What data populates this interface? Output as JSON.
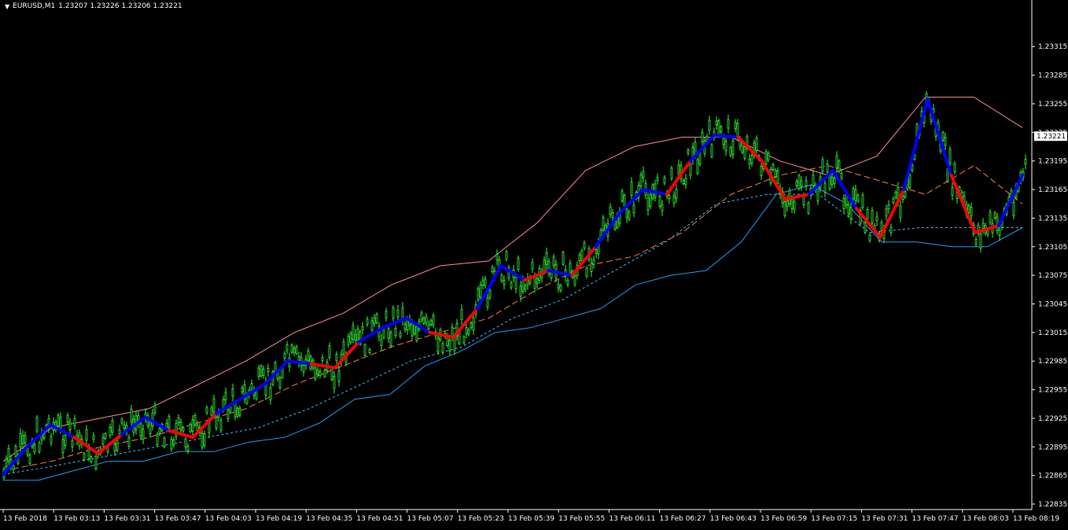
{
  "header": {
    "symbol": "EURUSD,M1",
    "ohlc": "1.23207 1.23226 1.23206 1.23221"
  },
  "colors": {
    "background": "#000000",
    "axis": "#ffffff",
    "bull_candle": "#32ff32",
    "bear_candle": "#32ff32",
    "line_up": "#0000ff",
    "line_down": "#ff0000",
    "band_outer_low": "#1ea0ff",
    "band_inner_low": "#3cc8ff",
    "band_mid": "#ff7f50",
    "band_upper": "#ff9090",
    "band_upper_inner": "#ffb0b0",
    "price_label_bg": "#ffffff"
  },
  "chart_data": {
    "type": "line",
    "title": "",
    "xlabel": "",
    "ylabel": "",
    "ylim": [
      1.22835,
      1.23335
    ],
    "current_price": "1.23221",
    "y_ticks": [
      "1.23315",
      "1.23285",
      "1.23255",
      "1.23225",
      "1.23195",
      "1.23165",
      "1.23135",
      "1.23105",
      "1.23075",
      "1.23045",
      "1.23015",
      "1.22985",
      "1.22955",
      "1.22925",
      "1.22895",
      "1.22865",
      "1.22835"
    ],
    "x_ticks": [
      "13 Feb 2018",
      "13 Feb 03:13",
      "13 Feb 03:31",
      "13 Feb 03:47",
      "13 Feb 04:03",
      "13 Feb 04:19",
      "13 Feb 04:35",
      "13 Feb 04:51",
      "13 Feb 05:07",
      "13 Feb 05:23",
      "13 Feb 05:39",
      "13 Feb 05:55",
      "13 Feb 06:11",
      "13 Feb 06:27",
      "13 Feb 06:43",
      "13 Feb 06:59",
      "13 Feb 07:15",
      "13 Feb 07:31",
      "13 Feb 07:47",
      "13 Feb 08:03",
      "13 Feb 08:19"
    ],
    "series": [
      {
        "role": "trend",
        "values": [
          1.22866,
          1.22895,
          1.22918,
          1.22905,
          1.22888,
          1.22908,
          1.22926,
          1.22912,
          1.22905,
          1.2293,
          1.22945,
          1.2296,
          1.22985,
          1.22982,
          1.22978,
          1.23005,
          1.2302,
          1.2303,
          1.23015,
          1.2301,
          1.2304,
          1.23085,
          1.2307,
          1.2308,
          1.23075,
          1.23105,
          1.2314,
          1.23165,
          1.2316,
          1.23195,
          1.23222,
          1.2322,
          1.23195,
          1.23155,
          1.2316,
          1.23185,
          1.23145,
          1.23115,
          1.23165,
          1.2326,
          1.2318,
          1.2312,
          1.23127,
          1.2318
        ],
        "direction": [
          "up",
          "up",
          "up",
          "down",
          "down",
          "up",
          "up",
          "down",
          "down",
          "up",
          "up",
          "up",
          "up",
          "down",
          "down",
          "up",
          "up",
          "up",
          "down",
          "down",
          "up",
          "up",
          "down",
          "up",
          "down",
          "up",
          "up",
          "up",
          "down",
          "up",
          "up",
          "down",
          "down",
          "down",
          "up",
          "up",
          "down",
          "down",
          "up",
          "up",
          "down",
          "down",
          "up",
          "up"
        ]
      },
      {
        "role": "lower-band-outer",
        "values": [
          1.2286,
          1.2286,
          1.2287,
          1.2288,
          1.2288,
          1.2289,
          1.2289,
          1.229,
          1.22905,
          1.2292,
          1.22945,
          1.2295,
          1.2298,
          1.22995,
          1.23015,
          1.2302,
          1.2303,
          1.2304,
          1.23065,
          1.23075,
          1.2308,
          1.2311,
          1.2316,
          1.2317,
          1.2315,
          1.2311,
          1.2311,
          1.23105,
          1.23105,
          1.23125
        ]
      },
      {
        "role": "lower-band-inner",
        "values": [
          1.22866,
          1.22875,
          1.22885,
          1.22895,
          1.22905,
          1.22915,
          1.22935,
          1.2296,
          1.22985,
          1.23,
          1.2303,
          1.2305,
          1.2308,
          1.2311,
          1.2315,
          1.2316,
          1.2316,
          1.2312,
          1.23125,
          1.23125,
          1.23125
        ]
      },
      {
        "role": "mid-band",
        "values": [
          1.2287,
          1.2288,
          1.22895,
          1.22905,
          1.2292,
          1.22935,
          1.2296,
          1.2298,
          1.23,
          1.23015,
          1.2303,
          1.2306,
          1.23085,
          1.23095,
          1.2312,
          1.2316,
          1.2318,
          1.2319,
          1.23175,
          1.2316,
          1.2319,
          1.2315
        ]
      },
      {
        "role": "upper-band",
        "values": [
          1.2288,
          1.22915,
          1.22925,
          1.22935,
          1.2296,
          1.22985,
          1.23015,
          1.23035,
          1.23065,
          1.23085,
          1.2309,
          1.2313,
          1.23185,
          1.2321,
          1.2322,
          1.2322,
          1.23195,
          1.2318,
          1.232,
          1.23262,
          1.23262,
          1.2323
        ]
      }
    ]
  }
}
